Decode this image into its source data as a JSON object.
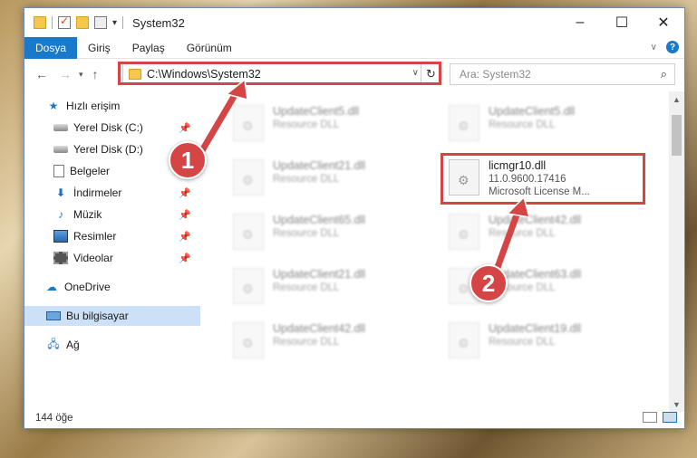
{
  "window": {
    "title": "System32"
  },
  "ribbon": {
    "tabs": [
      "Dosya",
      "Giriş",
      "Paylaş",
      "Görünüm"
    ]
  },
  "address": {
    "path": "C:\\Windows\\System32"
  },
  "search": {
    "placeholder": "Ara: System32"
  },
  "sidebar": {
    "quick_access": "Hızlı erişim",
    "items": [
      {
        "label": "Yerel Disk (C:)",
        "icon": "disk-icon",
        "pinned": true
      },
      {
        "label": "Yerel Disk (D:)",
        "icon": "disk-icon",
        "pinned": false
      },
      {
        "label": "Belgeler",
        "icon": "documents-icon",
        "pinned": true
      },
      {
        "label": "İndirmeler",
        "icon": "download-icon",
        "pinned": true
      },
      {
        "label": "Müzik",
        "icon": "music-icon",
        "pinned": true
      },
      {
        "label": "Resimler",
        "icon": "pictures-icon",
        "pinned": true
      },
      {
        "label": "Videolar",
        "icon": "videos-icon",
        "pinned": true
      }
    ],
    "onedrive": "OneDrive",
    "this_pc": "Bu bilgisayar",
    "network": "Ağ"
  },
  "files": [
    {
      "name": "UpdateClient5.dll",
      "sub": "Resource DLL",
      "blurred": true
    },
    {
      "name": "UpdateClient5.dll",
      "sub": "Resource DLL",
      "blurred": true
    },
    {
      "name": "UpdateClient21.dll",
      "sub": "Resource DLL",
      "blurred": true
    },
    {
      "name": "licmgr10.dll",
      "sub": "11.0.9600.17416",
      "sub2": "Microsoft License M...",
      "blurred": false
    },
    {
      "name": "UpdateClient65.dll",
      "sub": "Resource DLL",
      "blurred": true
    },
    {
      "name": "UpdateClient42.dll",
      "sub": "Resource DLL",
      "blurred": true
    },
    {
      "name": "UpdateClient21.dll",
      "sub": "Resource DLL",
      "blurred": true
    },
    {
      "name": "UpdateClient63.dll",
      "sub": "Resource DLL",
      "blurred": true
    },
    {
      "name": "UpdateClient42.dll",
      "sub": "Resource DLL",
      "blurred": true
    },
    {
      "name": "UpdateClient19.dll",
      "sub": "Resource DLL",
      "blurred": true
    }
  ],
  "status": {
    "count": "144 öğe"
  },
  "annotations": {
    "step1": "1",
    "step2": "2",
    "color": "#d64545"
  }
}
